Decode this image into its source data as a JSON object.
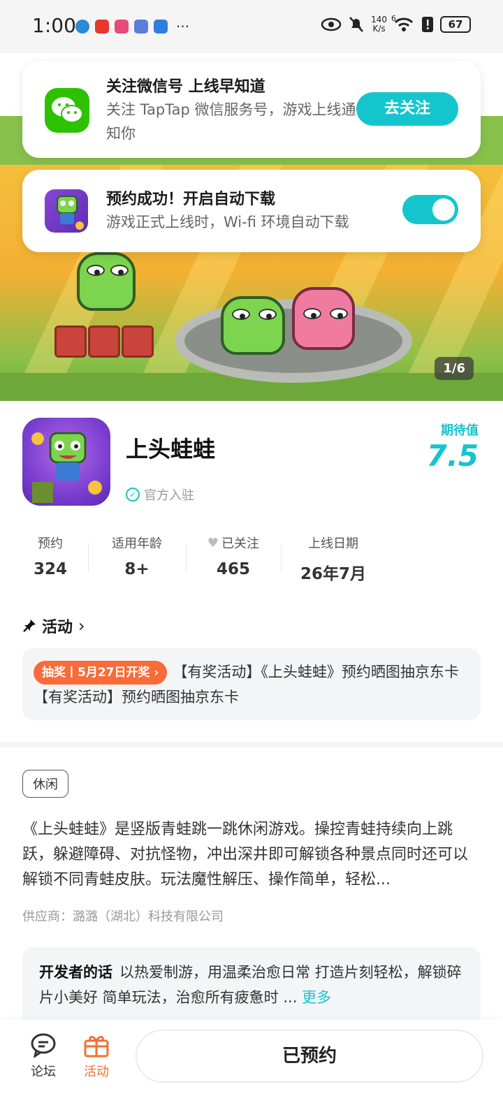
{
  "status_bar": {
    "time": "1:00",
    "net_speed_value": "140",
    "net_speed_unit": "K/s",
    "signal_label": "6",
    "battery": "67",
    "more": "···"
  },
  "notification_follow": {
    "title": "关注微信号 上线早知道",
    "text": "关注 TapTap 微信服务号，游戏上线通知你",
    "button": "去关注"
  },
  "notification_auto_download": {
    "title": "预约成功！开启自动下载",
    "text": "游戏正式上线时，Wi-fi 环境自动下载",
    "toggle_on": true
  },
  "banner": {
    "counter": "1/6"
  },
  "game": {
    "name": "上头蛙蛙",
    "official": "官方入驻",
    "expect_label": "期待值",
    "expect_value": "7.5"
  },
  "stats": [
    {
      "label": "预约",
      "value": "324"
    },
    {
      "label": "适用年龄",
      "value": "8+"
    },
    {
      "label": "已关注",
      "value": "465"
    },
    {
      "label": "上线日期",
      "value": "26年7月"
    }
  ],
  "activity": {
    "heading": "活动",
    "badge": "抽奖丨5月27日开奖 ›",
    "text": "【有奖活动】《上头蛙蛙》预约晒图抽京东卡 【有奖活动】预约晒图抽京东卡"
  },
  "tag": "休闲",
  "description": "《上头蛙蛙》是竖版青蛙跳一跳休闲游戏。操控青蛙持续向上跳跃，躲避障碍、对抗怪物，冲出深井即可解锁各种景点同时还可以解锁不同青蛙皮肤。玩法魔性解压、操作简单，轻松...",
  "supplier": "供应商：潞潞（湖北）科技有限公司",
  "developer_note": {
    "label": "开发者的话",
    "text": "以热爱制游，用温柔治愈日常 打造片刻轻松，解锁碎片小美好 简单玩法，治愈所有疲惫时 ...",
    "more": "更多"
  },
  "bottom_nav": {
    "forum": "论坛",
    "activity": "活动",
    "reserved_button": "已预约"
  },
  "colors": {
    "accent": "#15c5ce",
    "orange": "#f07033",
    "lottery": "#fa6b3a"
  }
}
